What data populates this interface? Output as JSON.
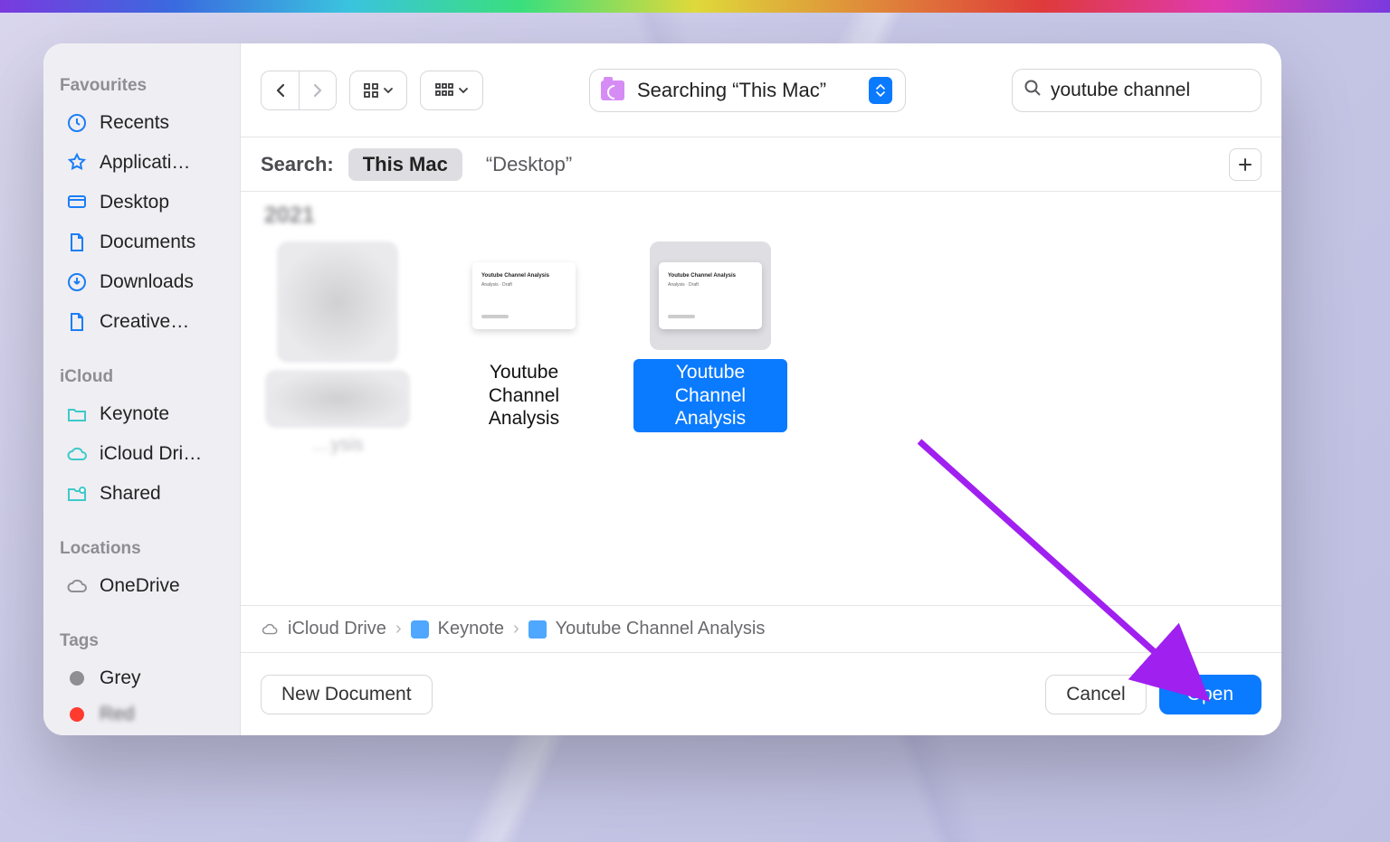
{
  "sidebar": {
    "sections": [
      {
        "label": "Favourites",
        "items": [
          {
            "icon": "clock",
            "label": "Recents"
          },
          {
            "icon": "app",
            "label": "Applicati…"
          },
          {
            "icon": "desktop",
            "label": "Desktop"
          },
          {
            "icon": "doc",
            "label": "Documents"
          },
          {
            "icon": "download",
            "label": "Downloads"
          },
          {
            "icon": "doc",
            "label": "Creative…"
          }
        ]
      },
      {
        "label": "iCloud",
        "items": [
          {
            "icon": "folder",
            "label": "Keynote"
          },
          {
            "icon": "cloud",
            "label": "iCloud Dri…"
          },
          {
            "icon": "shared",
            "label": "Shared"
          }
        ]
      },
      {
        "label": "Locations",
        "items": [
          {
            "icon": "cloud-grey",
            "label": "OneDrive"
          }
        ]
      },
      {
        "label": "Tags",
        "items": [
          {
            "icon": "tag-grey",
            "label": "Grey"
          },
          {
            "icon": "tag-red",
            "label": "Red"
          }
        ]
      }
    ]
  },
  "toolbar": {
    "location_text": "Searching “This Mac”",
    "search_value": "youtube channel"
  },
  "filter": {
    "label": "Search:",
    "scopes": [
      {
        "text": "This Mac",
        "active": true
      },
      {
        "text": "“Desktop”",
        "active": false
      }
    ]
  },
  "content": {
    "year": "2021",
    "files": [
      {
        "name": "",
        "blurred": true
      },
      {
        "name": "Youtube Channel Analysis",
        "thumb_title": "Youtube Channel Analysis",
        "selected": false
      },
      {
        "name": "Youtube Channel Analysis",
        "thumb_title": "Youtube Channel Analysis",
        "selected": true
      }
    ],
    "blurred_row2_label": "…ysis"
  },
  "breadcrumb": {
    "items": [
      {
        "icon": "cloud",
        "label": "iCloud Drive"
      },
      {
        "icon": "app",
        "label": "Keynote"
      },
      {
        "icon": "doc",
        "label": "Youtube Channel Analysis"
      }
    ]
  },
  "footer": {
    "new_doc": "New Document",
    "cancel": "Cancel",
    "open": "Open"
  },
  "colors": {
    "accent": "#0a7aff",
    "annotation": "#a020f0"
  }
}
